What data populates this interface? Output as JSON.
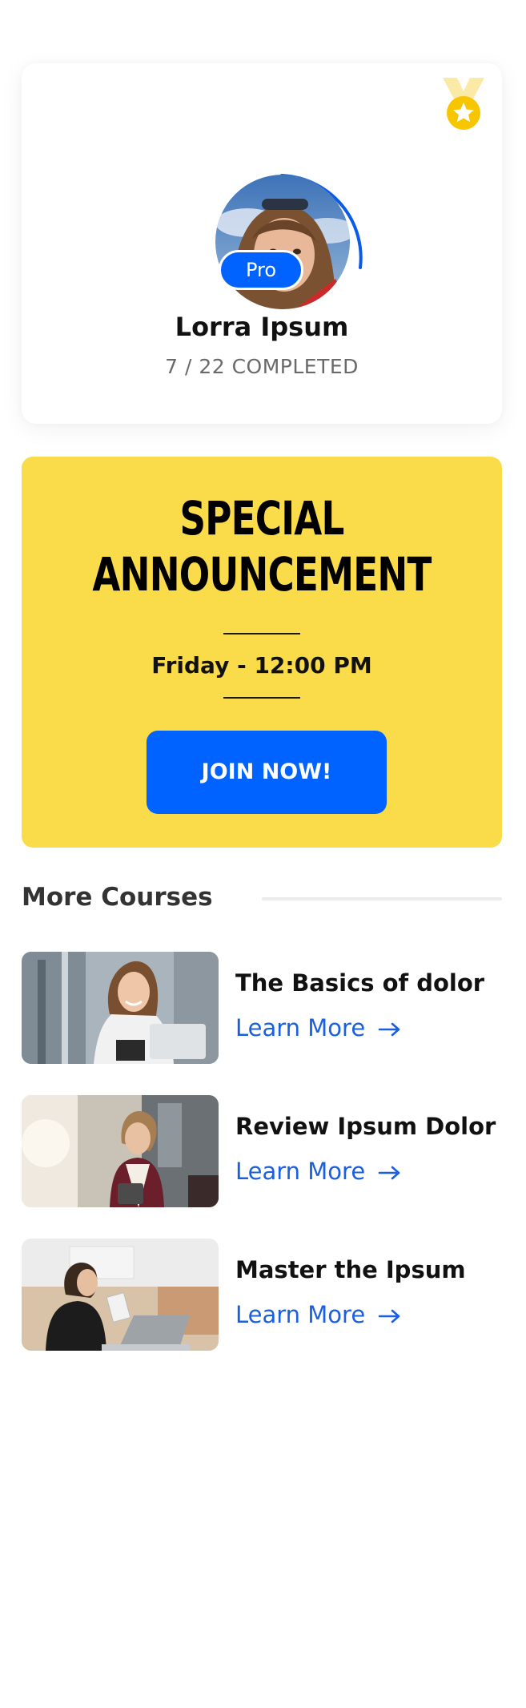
{
  "profile": {
    "name": "Lorra Ipsum",
    "badge": "Pro",
    "progress_text": "7 / 22 COMPLETED",
    "completed": 7,
    "total": 22,
    "medal_icon": "medal-icon",
    "accent": "#0062ff"
  },
  "announcement": {
    "title_line1": "SPECIAL",
    "title_line2": "ANNOUNCEMENT",
    "time": "Friday - 12:00 PM",
    "cta_label": "JOIN NOW!",
    "background": "#fadc4a"
  },
  "more_courses": {
    "title": "More Courses",
    "items": [
      {
        "title": "The Basics of dolor",
        "link_label": "Learn More",
        "icon": "arrow-right-icon"
      },
      {
        "title": "Review Ipsum Dolor",
        "link_label": "Learn More",
        "icon": "arrow-right-icon"
      },
      {
        "title": "Master the Ipsum",
        "link_label": "Learn More",
        "icon": "arrow-right-icon"
      }
    ]
  },
  "colors": {
    "brand_blue": "#0062ff",
    "link_blue": "#1a5fe0",
    "announcement_yellow": "#fadc4a",
    "medal_gold": "#f7c600"
  }
}
